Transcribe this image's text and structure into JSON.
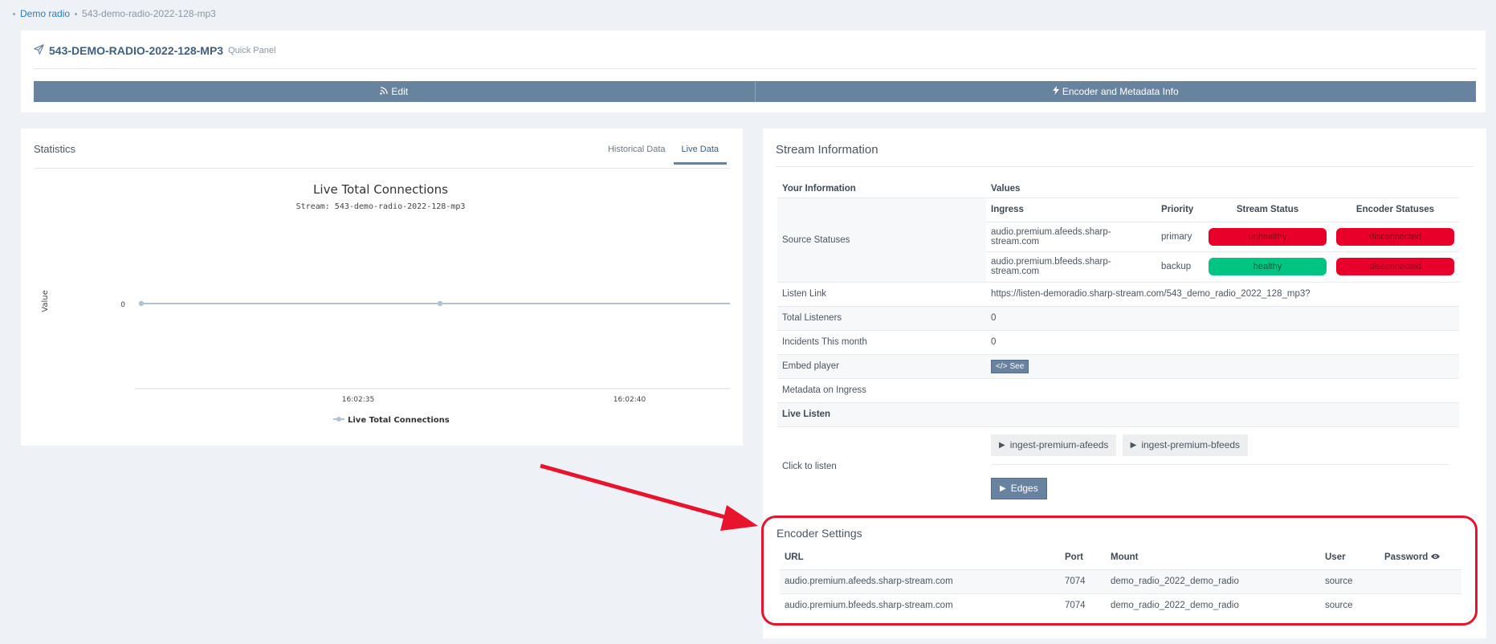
{
  "breadcrumb": {
    "parent": "Demo radio",
    "current": "543-demo-radio-2022-128-mp3"
  },
  "quick_panel": {
    "title": "543-DEMO-RADIO-2022-128-MP3",
    "subtitle": "Quick Panel",
    "edit_label": "Edit",
    "encoder_info_label": "Encoder and Metadata Info"
  },
  "statistics": {
    "title": "Statistics",
    "tabs": [
      {
        "label": "Historical Data"
      },
      {
        "label": "Live Data"
      }
    ],
    "active_tab": "Live Data"
  },
  "chart_data": {
    "type": "line",
    "title": "Live Total Connections",
    "subtitle": "Stream: 543-demo-radio-2022-128-mp3",
    "ylabel": "Value",
    "xlabel": "",
    "x_tick_labels": [
      "16:02:35",
      "16:02:40"
    ],
    "y_tick_labels": [
      "0"
    ],
    "series": [
      {
        "name": "Live Total Connections",
        "x": [
          0,
          1,
          2
        ],
        "values": [
          0,
          0,
          0
        ]
      }
    ],
    "legend": "bottom-center",
    "grid": false,
    "color": "#b4c1cf"
  },
  "stream_info": {
    "title": "Stream Information",
    "header": {
      "col1": "Your Information",
      "col2": "Values"
    },
    "source_statuses": {
      "label": "Source Statuses",
      "columns": [
        "Ingress",
        "Priority",
        "Stream Status",
        "Encoder Statuses"
      ],
      "rows": [
        {
          "ingress": "audio.premium.afeeds.sharp-stream.com",
          "priority": "primary",
          "stream_status": "unhealthy",
          "encoder_status": "disconnected"
        },
        {
          "ingress": "audio.premium.bfeeds.sharp-stream.com",
          "priority": "backup",
          "stream_status": "healthy",
          "encoder_status": "disconnected"
        }
      ]
    },
    "listen_link": {
      "label": "Listen Link",
      "value": "https://listen-demoradio.sharp-stream.com/543_demo_radio_2022_128_mp3?"
    },
    "total_listeners": {
      "label": "Total Listeners",
      "value": "0"
    },
    "incidents": {
      "label": "Incidents This month",
      "value": "0"
    },
    "embed": {
      "label": "Embed player",
      "button": "See"
    },
    "metadata": {
      "label": "Metadata on Ingress",
      "value": ""
    },
    "live_listen": {
      "label": "Live Listen"
    },
    "click_to_listen": {
      "label": "Click to listen",
      "buttons": [
        "ingest-premium-afeeds",
        "ingest-premium-bfeeds"
      ],
      "edges_label": "Edges"
    }
  },
  "encoder_settings": {
    "title": "Encoder Settings",
    "columns": {
      "url": "URL",
      "port": "Port",
      "mount": "Mount",
      "user": "User",
      "password": "Password"
    },
    "rows": [
      {
        "url": "audio.premium.afeeds.sharp-stream.com",
        "port": "7074",
        "mount": "demo_radio_2022_demo_radio",
        "user": "source"
      },
      {
        "url": "audio.premium.bfeeds.sharp-stream.com",
        "port": "7074",
        "mount": "demo_radio_2022_demo_radio",
        "user": "source"
      }
    ]
  },
  "colors": {
    "accent": "#68839f",
    "link": "#2b7bbd",
    "danger": "#e8002b",
    "success": "#00c482",
    "highlight": "#e8132c"
  }
}
